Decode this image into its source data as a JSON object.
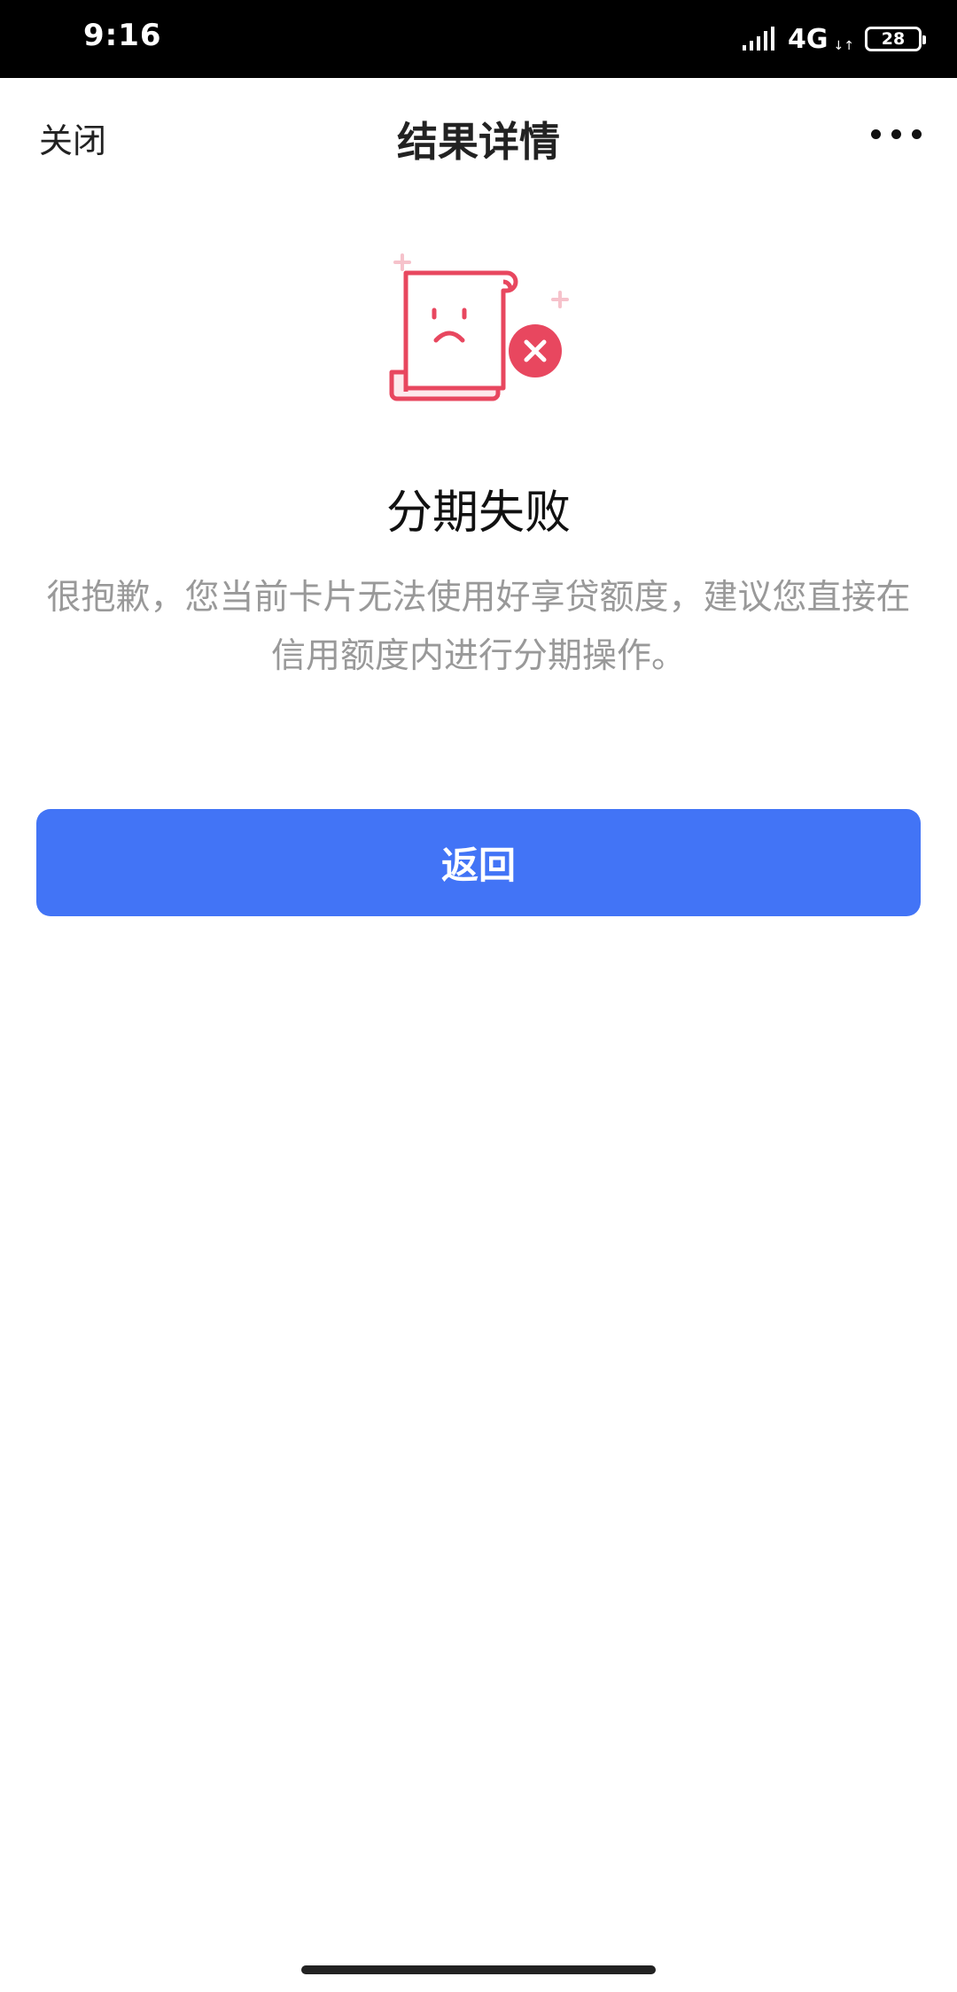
{
  "status_bar": {
    "time": "9:16",
    "network": "4G",
    "network_arrows": "↓↑",
    "battery": "28",
    "signal_icon": "signal-bars-icon"
  },
  "nav": {
    "close_label": "关闭",
    "title": "结果详情",
    "more_icon": "more-dots-icon"
  },
  "illustration": {
    "icon": "failed-document-icon",
    "accent_color": "#e8475f",
    "light_color": "#fde9ec"
  },
  "result": {
    "title": "分期失败",
    "description": "很抱歉，您当前卡片无法使用好享贷额度，建议您直接在信用额度内进行分期操作。"
  },
  "actions": {
    "back_label": "返回",
    "back_color": "#4274f6"
  }
}
